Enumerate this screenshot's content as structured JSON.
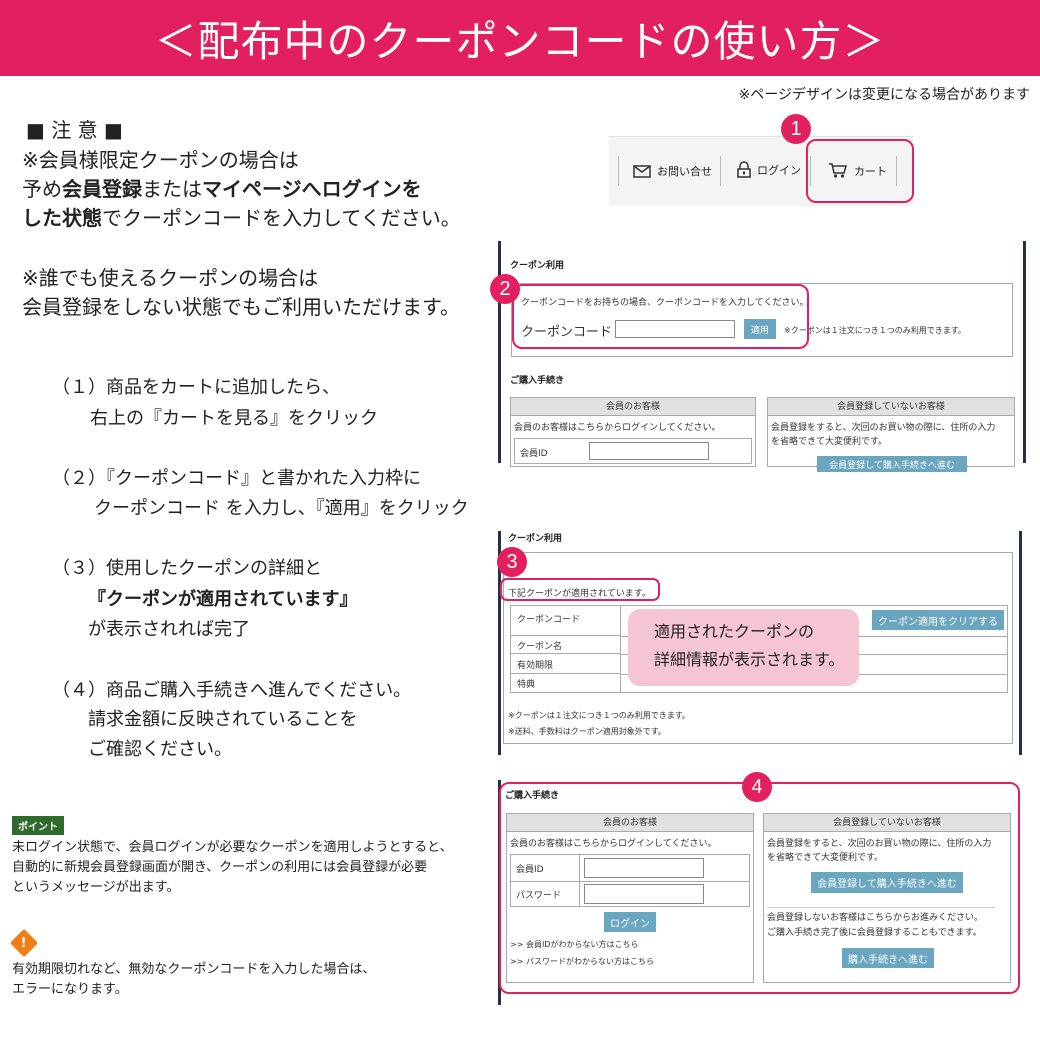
{
  "banner": {
    "title": "＜配布中のクーポンコードの使い方＞"
  },
  "design_note": "※ページデザインは変更になる場合があります",
  "caution": {
    "heading": "■ 注 意 ■",
    "line1": "※会員様限定クーポンの場合は",
    "line2_pre": "予め",
    "line2_b1": "会員登録",
    "line2_mid": "または",
    "line2_b2": "マイページへログインを",
    "line3_b": "した状態",
    "line3_post": "でクーポンコードを入力してください。",
    "line4": "※誰でも使えるクーポンの場合は",
    "line5": "会員登録をしない状態でもご利用いただけます。"
  },
  "steps": {
    "s1a": "（１）商品をカートに追加したら、",
    "s1b": "右上の『カートを見る』をクリック",
    "s2a": "（２）『クーポンコード』と書かれた入力枠に",
    "s2b": "クーポンコード を入力し、『適用』をクリック",
    "s3a": "（３）使用したクーポンの詳細と",
    "s3b": "『クーポンが適用されています』",
    "s3c": "が表示されれば完了",
    "s4a": "（４）商品ご購入手続きへ進んでください。",
    "s4b": "請求金額に反映されていることを",
    "s4c": "ご確認ください。"
  },
  "point": {
    "badge": "ポイント",
    "line1": "未ログイン状態で、会員ログインが必要なクーポンを適用しようとすると、",
    "line2": "自動的に新規会員登録画面が開き、クーポンの利用には会員登録が必要",
    "line3": "というメッセージが出ます。"
  },
  "warning": {
    "mark": "!",
    "line1": "有効期限切れなど、無効なクーポンコードを入力した場合は、",
    "line2": "エラーになります。"
  },
  "markers": {
    "m1": "1",
    "m2": "2",
    "m3": "3",
    "m4": "4"
  },
  "nav": {
    "contact": "お問い合せ",
    "login": "ログイン",
    "cart": "カート"
  },
  "shot1": {
    "coupon_section": "クーポン利用",
    "coupon_prompt": "クーポンコードをお持ちの場合、クーポンコードを入力してください。",
    "coupon_label": "クーポンコード",
    "apply": "適用",
    "coupon_note": "※クーポンは１注文につき１つのみ利用できます。",
    "purchase_section": "ご購入手続き",
    "member_header": "会員のお客様",
    "member_desc": "会員のお客様はこちらからログインしてください。",
    "member_id": "会員ID",
    "guest_header": "会員登録していないお客様",
    "guest_desc1": "会員登録をすると、次回のお買い物の際に、住所の入力",
    "guest_desc2": "を省略できて大変便利です。",
    "guest_btn": "会員登録して購入手続きへ進む"
  },
  "shot2": {
    "coupon_section": "クーポン利用",
    "applied_msg": "下記クーポンが適用されています。",
    "rows": [
      "クーポンコード",
      "クーポン名",
      "有効期限",
      "特典"
    ],
    "clear_btn": "クーポン適用をクリアする",
    "bubble1": "適用されたクーポンの",
    "bubble2": "詳細情報が表示されます。",
    "note1": "※クーポンは１注文につき１つのみ利用できます。",
    "note2": "※送料、手数料はクーポン適用対象外です。"
  },
  "shot3": {
    "purchase_section": "ご購入手続き",
    "member_header": "会員のお客様",
    "member_desc": "会員のお客様はこちらからログインしてください。",
    "member_id": "会員ID",
    "password": "パスワード",
    "login_btn": "ログイン",
    "forgot_id": ">> 会員IDがわからない方はこちら",
    "forgot_pw": ">> パスワードがわからない方はこちら",
    "guest_header": "会員登録していないお客様",
    "guest_desc1": "会員登録をすると、次回のお買い物の際に、住所の入力",
    "guest_desc2": "を省略できて大変便利です。",
    "register_btn": "会員登録して購入手続きへ進む",
    "noreg1": "会員登録しないお客様はこちらからお進みください。",
    "noreg2": "ご購入手続き完了後に会員登録することもできます。",
    "purchase_btn": "購入手続きへ進む"
  },
  "colors": {
    "brand": "#e3205f",
    "button": "#6aa6bf",
    "point_badge": "#2f6b2c",
    "warning": "#f07f1a",
    "bubble": "#f6c5d3"
  }
}
